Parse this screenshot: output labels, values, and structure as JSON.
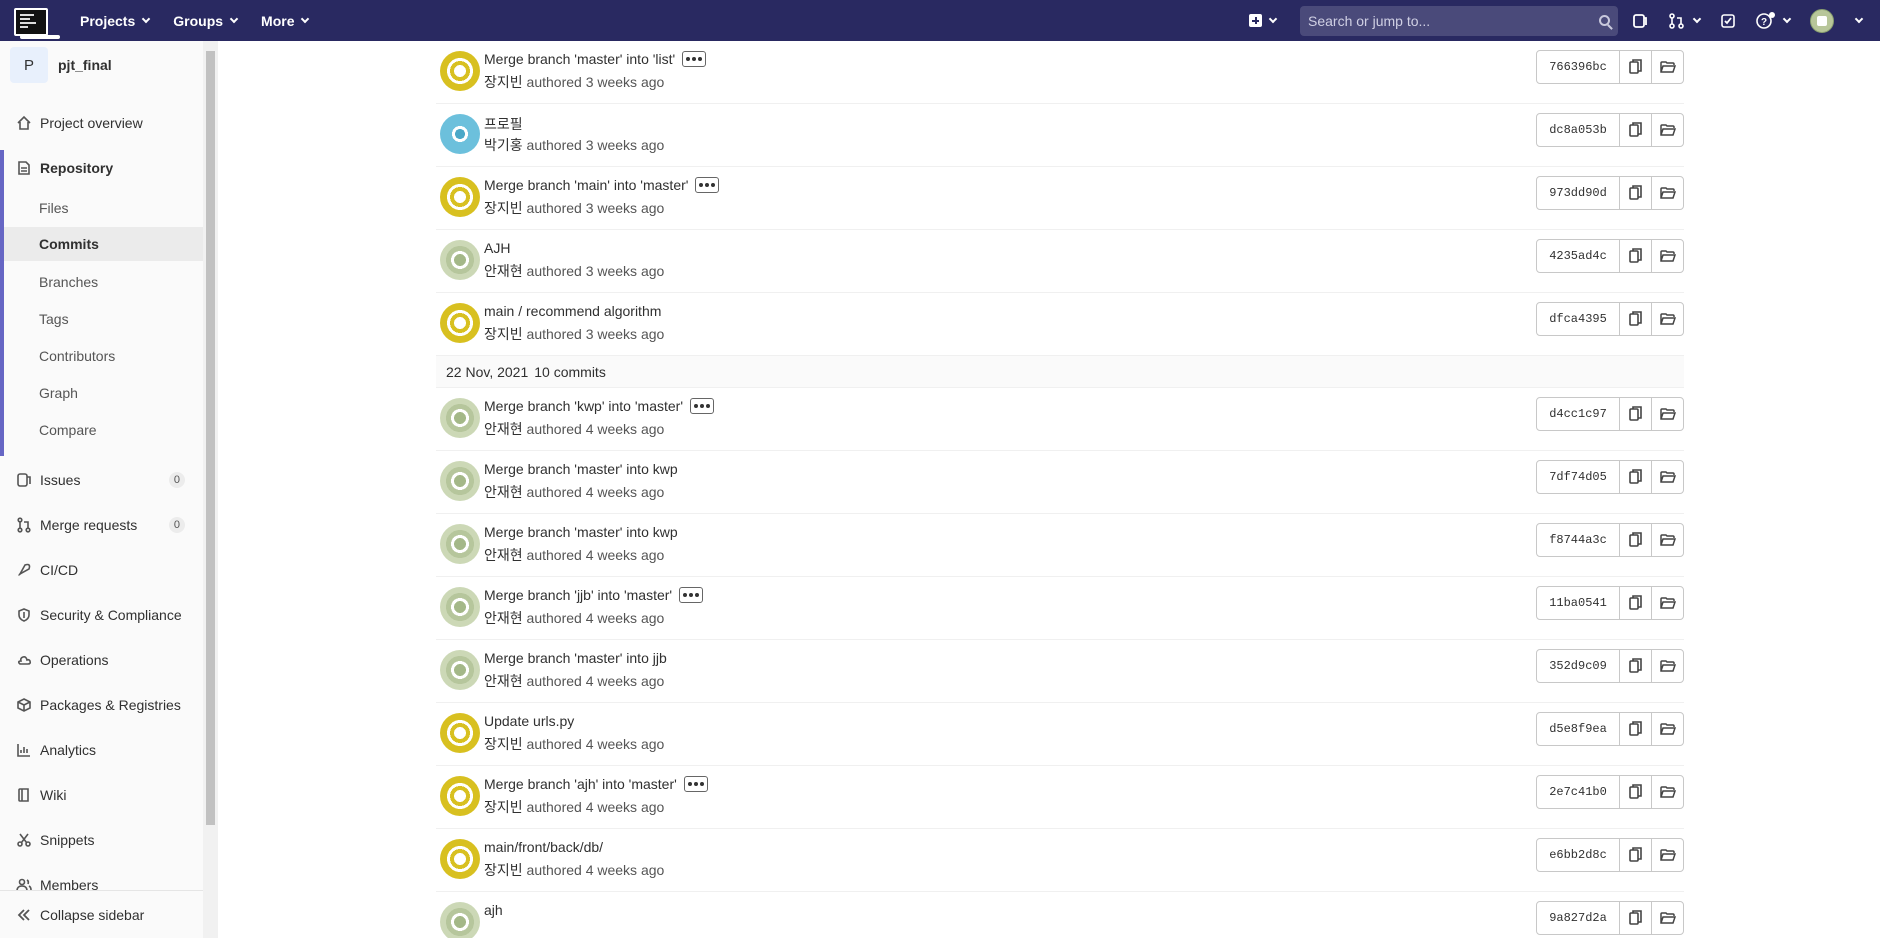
{
  "navbar": {
    "menu": [
      {
        "label": "Projects"
      },
      {
        "label": "Groups"
      },
      {
        "label": "More"
      }
    ],
    "search_placeholder": "Search or jump to..."
  },
  "sidebar": {
    "project_initial": "P",
    "project_name": "pjt_final",
    "overview": "Project overview",
    "repository": "Repository",
    "repo_items": [
      "Files",
      "Commits",
      "Branches",
      "Tags",
      "Contributors",
      "Graph",
      "Compare"
    ],
    "issues": {
      "label": "Issues",
      "count": "0"
    },
    "merge_requests": {
      "label": "Merge requests",
      "count": "0"
    },
    "items": [
      "CI/CD",
      "Security & Compliance",
      "Operations",
      "Packages & Registries",
      "Analytics",
      "Wiki",
      "Snippets",
      "Members"
    ],
    "collapse": "Collapse sidebar"
  },
  "commits_top": [
    {
      "title": "Merge branch 'master' into 'list'",
      "author": "장지빈",
      "meta": "authored 3 weeks ago",
      "sha": "766396bc",
      "avatar": "yellow",
      "ellipsis": true
    },
    {
      "title": "프로필",
      "author": "박기홍",
      "meta": "authored 3 weeks ago",
      "sha": "dc8a053b",
      "avatar": "blue",
      "ellipsis": false
    },
    {
      "title": "Merge branch 'main' into 'master'",
      "author": "장지빈",
      "meta": "authored 3 weeks ago",
      "sha": "973dd90d",
      "avatar": "yellow",
      "ellipsis": true
    },
    {
      "title": "AJH",
      "author": "안재현",
      "meta": "authored 3 weeks ago",
      "sha": "4235ad4c",
      "avatar": "green",
      "ellipsis": false
    },
    {
      "title": "main / recommend algorithm",
      "author": "장지빈",
      "meta": "authored 3 weeks ago",
      "sha": "dfca4395",
      "avatar": "yellow",
      "ellipsis": false
    }
  ],
  "day_header": {
    "date": "22 Nov, 2021",
    "count": "10 commits"
  },
  "commits_bottom": [
    {
      "title": "Merge branch 'kwp' into 'master'",
      "author": "안재현",
      "meta": "authored 4 weeks ago",
      "sha": "d4cc1c97",
      "avatar": "green",
      "ellipsis": true
    },
    {
      "title": "Merge branch 'master' into kwp",
      "author": "안재현",
      "meta": "authored 4 weeks ago",
      "sha": "7df74d05",
      "avatar": "green",
      "ellipsis": false
    },
    {
      "title": "Merge branch 'master' into kwp",
      "author": "안재현",
      "meta": "authored 4 weeks ago",
      "sha": "f8744a3c",
      "avatar": "green",
      "ellipsis": false
    },
    {
      "title": "Merge branch 'jjb' into 'master'",
      "author": "안재현",
      "meta": "authored 4 weeks ago",
      "sha": "11ba0541",
      "avatar": "green",
      "ellipsis": true
    },
    {
      "title": "Merge branch 'master' into jjb",
      "author": "안재현",
      "meta": "authored 4 weeks ago",
      "sha": "352d9c09",
      "avatar": "green",
      "ellipsis": false
    },
    {
      "title": "Update urls.py",
      "author": "장지빈",
      "meta": "authored 4 weeks ago",
      "sha": "d5e8f9ea",
      "avatar": "yellow",
      "ellipsis": false
    },
    {
      "title": "Merge branch 'ajh' into 'master'",
      "author": "장지빈",
      "meta": "authored 4 weeks ago",
      "sha": "2e7c41b0",
      "avatar": "yellow",
      "ellipsis": true
    },
    {
      "title": "main/front/back/db/",
      "author": "장지빈",
      "meta": "authored 4 weeks ago",
      "sha": "e6bb2d8c",
      "avatar": "yellow",
      "ellipsis": false
    },
    {
      "title": "ajh",
      "author": "",
      "meta": "",
      "sha": "9a827d2a",
      "avatar": "green",
      "ellipsis": false
    }
  ],
  "colors": {
    "navbar": "#292961",
    "sidebar_active": "#6666c4"
  }
}
